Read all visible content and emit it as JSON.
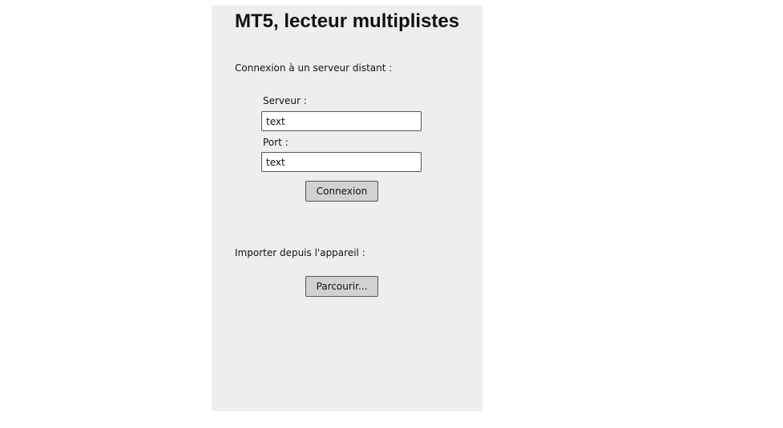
{
  "app": {
    "title": "MT5, lecteur multiplistes"
  },
  "remote": {
    "section_label": "Connexion à un serveur distant :",
    "server_label": "Serveur :",
    "server_value": "text",
    "port_label": "Port :",
    "port_value": "text",
    "connect_label": "Connexion"
  },
  "import": {
    "section_label": "Importer depuis l'appareil :",
    "browse_label": "Parcourir..."
  },
  "colors": {
    "panel_background": "#eeeeee",
    "button_background": "#d2d2d2",
    "border": "#555555"
  }
}
